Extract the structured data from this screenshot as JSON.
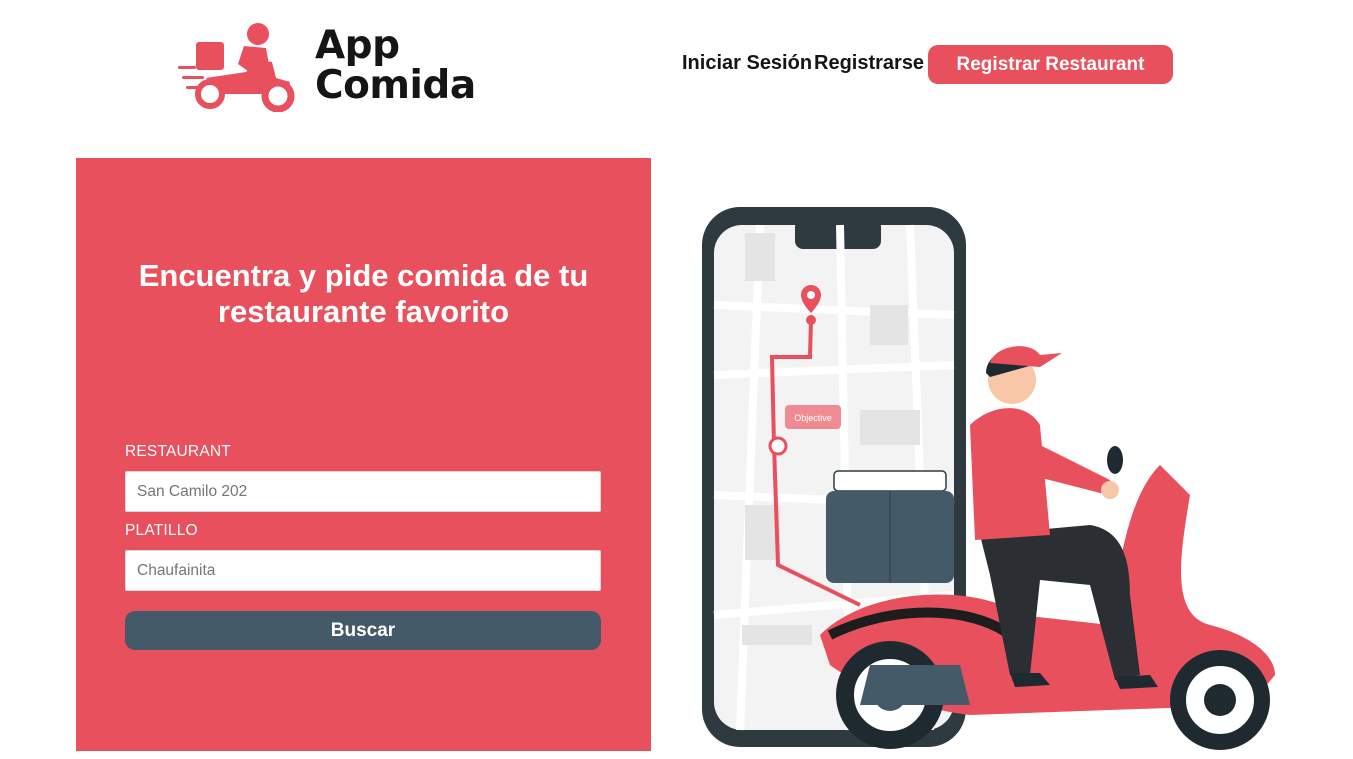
{
  "header": {
    "logo": {
      "line1": "App",
      "line2": "Comida",
      "icon": "delivery-scooter-icon"
    },
    "nav": {
      "login": "Iniciar Sesión",
      "register": "Registrarse",
      "cta": "Registrar Restaurant"
    }
  },
  "hero": {
    "title_line1": "Encuentra y pide comida de tu",
    "title_line2": "restaurante favorito",
    "form": {
      "restaurant_label": "RESTAURANT",
      "restaurant_placeholder": "San Camilo 202",
      "dish_label": "PLATILLO",
      "dish_placeholder": "Chaufainita",
      "search_button": "Buscar"
    }
  },
  "illustration": {
    "map_tooltip": "Objective"
  },
  "colors": {
    "brand": "#e9505d",
    "button_dark": "#455a69",
    "text": "#151515"
  }
}
